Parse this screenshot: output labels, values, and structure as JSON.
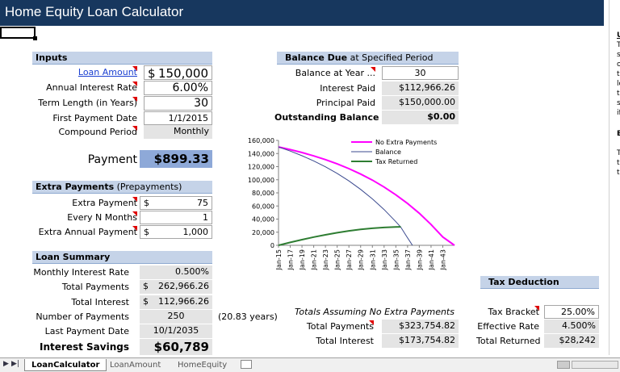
{
  "title": "Home Equity Loan Calculator",
  "inputs": {
    "header": "Inputs",
    "loan_amount_label": "Loan Amount",
    "loan_amount_currency": "$",
    "loan_amount_value": "150,000",
    "rate_label": "Annual Interest Rate",
    "rate_value": "6.00%",
    "term_label": "Term Length (in Years)",
    "term_value": "30",
    "first_payment_label": "First Payment Date",
    "first_payment_value": "1/1/2015",
    "compound_label": "Compound Period",
    "compound_value": "Monthly"
  },
  "payment": {
    "label": "Payment",
    "value": "$899.33"
  },
  "extra": {
    "header_bold": "Extra Payments",
    "header_normal": " (Prepayments)",
    "extra_payment_label": "Extra Payment",
    "extra_payment_currency": "$",
    "extra_payment_value": "75",
    "every_n_label": "Every N Months",
    "every_n_value": "1",
    "annual_label": "Extra Annual Payment",
    "annual_currency": "$",
    "annual_value": "1,000"
  },
  "summary": {
    "header": "Loan Summary",
    "monthly_rate_label": "Monthly Interest Rate",
    "monthly_rate_value": "0.500%",
    "total_payments_label": "Total Payments",
    "total_payments_currency": "$",
    "total_payments_value": "262,966.26",
    "total_interest_label": "Total Interest",
    "total_interest_currency": "$",
    "total_interest_value": "112,966.26",
    "num_payments_label": "Number of Payments",
    "num_payments_value": "250",
    "years_note": "(20.83 years)",
    "last_date_label": "Last Payment Date",
    "last_date_value": "10/1/2035",
    "savings_label": "Interest Savings",
    "savings_value": "$60,789"
  },
  "balance_due": {
    "header_bold": "Balance Due",
    "header_normal": " at Specified Period",
    "year_label": "Balance at Year ...",
    "year_value": "30",
    "interest_paid_label": "Interest Paid",
    "interest_paid_value": "$112,966.26",
    "principal_paid_label": "Principal Paid",
    "principal_paid_value": "$150,000.00",
    "outstanding_label": "Outstanding Balance",
    "outstanding_value": "$0.00"
  },
  "no_extra": {
    "caption": "Totals Assuming No Extra Payments",
    "total_payments_label": "Total Payments",
    "total_payments_value": "$323,754.82",
    "total_interest_label": "Total Interest",
    "total_interest_value": "$173,754.82"
  },
  "tax": {
    "header": "Tax Deduction",
    "bracket_label": "Tax Bracket",
    "bracket_value": "25.00%",
    "effective_label": "Effective Rate",
    "effective_value": "4.500%",
    "returned_label": "Total Returned",
    "returned_value": "$28,242"
  },
  "side_panel": {
    "heading_letter": "U",
    "body_letters": [
      "T",
      "s",
      "o",
      "t",
      "lo",
      "t",
      "s",
      "if"
    ],
    "heading2_letter": "E",
    "body2_letters": [
      "T",
      "t",
      "t"
    ]
  },
  "tabs": [
    "LoanCalculator",
    "LoanAmount",
    "HomeEquity"
  ],
  "chart_data": {
    "type": "line",
    "y_ticks": [
      "160,000",
      "140,000",
      "120,000",
      "100,000",
      "80,000",
      "60,000",
      "40,000",
      "20,000",
      "0"
    ],
    "ylim": [
      0,
      160000
    ],
    "x_ticks": [
      "Jan-15",
      "Jan-17",
      "Jan-19",
      "Jan-21",
      "Jan-23",
      "Jan-25",
      "Jan-27",
      "Jan-29",
      "Jan-31",
      "Jan-33",
      "Jan-35",
      "Jan-37",
      "Jan-39",
      "Jan-41",
      "Jan-43"
    ],
    "x_range_months": [
      0,
      360
    ],
    "series": [
      {
        "name": "No Extra Payments",
        "color": "#ff00ff",
        "points": [
          [
            0,
            150000
          ],
          [
            24,
            146000
          ],
          [
            48,
            141500
          ],
          [
            72,
            136400
          ],
          [
            96,
            130700
          ],
          [
            120,
            124200
          ],
          [
            144,
            116900
          ],
          [
            168,
            108700
          ],
          [
            192,
            99400
          ],
          [
            216,
            88900
          ],
          [
            240,
            77100
          ],
          [
            264,
            63800
          ],
          [
            288,
            48800
          ],
          [
            312,
            31800
          ],
          [
            336,
            12700
          ],
          [
            360,
            0
          ]
        ]
      },
      {
        "name": "Balance",
        "color": "#3b4a8f",
        "points": [
          [
            0,
            150000
          ],
          [
            24,
            143700
          ],
          [
            48,
            136600
          ],
          [
            72,
            128700
          ],
          [
            96,
            119700
          ],
          [
            120,
            109600
          ],
          [
            144,
            98200
          ],
          [
            168,
            85300
          ],
          [
            192,
            70800
          ],
          [
            216,
            54500
          ],
          [
            240,
            36100
          ],
          [
            250,
            27800
          ],
          [
            262,
            13500
          ],
          [
            274,
            0
          ]
        ]
      },
      {
        "name": "Tax Returned",
        "color": "#2e7d32",
        "points": [
          [
            0,
            0
          ],
          [
            24,
            4400
          ],
          [
            48,
            8600
          ],
          [
            72,
            12500
          ],
          [
            96,
            16000
          ],
          [
            120,
            19200
          ],
          [
            144,
            22000
          ],
          [
            168,
            24300
          ],
          [
            192,
            26000
          ],
          [
            216,
            27200
          ],
          [
            240,
            28000
          ],
          [
            250,
            28242
          ]
        ]
      }
    ]
  }
}
